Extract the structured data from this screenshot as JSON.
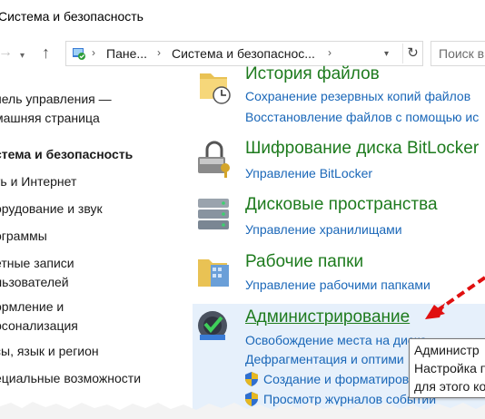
{
  "window": {
    "title": "Система и безопасность"
  },
  "address": {
    "crumbs": [
      "Пане...",
      "Система и безопаснос..."
    ],
    "search_placeholder": "Поиск в"
  },
  "sidebar": {
    "items": [
      {
        "label": "нель управления —"
      },
      {
        "label": "машняя страница"
      },
      {
        "label": "стема и безопасность"
      },
      {
        "label": "ть и Интернет"
      },
      {
        "label": "орудование и звук"
      },
      {
        "label": "ограммы"
      },
      {
        "label": "етные записи"
      },
      {
        "label": "льзователей"
      },
      {
        "label": "ормление и"
      },
      {
        "label": "рсонализация"
      },
      {
        "label": "сы, язык и регион"
      },
      {
        "label": "ециальные возможности"
      }
    ]
  },
  "categories": {
    "history": {
      "title": "История файлов",
      "links": [
        "Сохранение резервных копий файлов",
        "Восстановление файлов с помощью ис"
      ]
    },
    "bitlocker": {
      "title": "Шифрование диска BitLocker",
      "links": [
        "Управление BitLocker"
      ]
    },
    "spaces": {
      "title": "Дисковые пространства",
      "links": [
        "Управление хранилищами"
      ]
    },
    "workfolders": {
      "title": "Рабочие папки",
      "links": [
        "Управление рабочими папками"
      ]
    },
    "admin": {
      "title": "Администрирование",
      "links": [
        "Освобождение места на диске",
        "Дефрагментация и оптими",
        "Создание и форматирован",
        "Просмотр журналов событий"
      ]
    }
  },
  "tooltip": {
    "lines": [
      "Администр",
      "Настройка п",
      "для этого ко"
    ]
  },
  "colors": {
    "category_title": "#1e7b1e",
    "link": "#1a67b8",
    "highlight": "#e6f0fb",
    "arrow": "#e01010"
  }
}
